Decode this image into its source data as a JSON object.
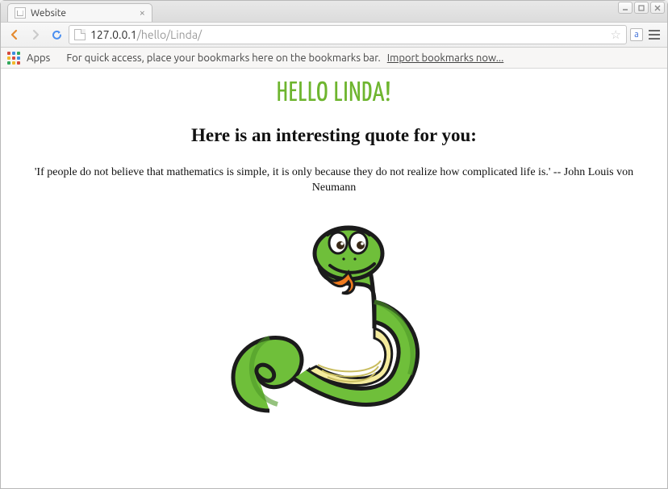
{
  "window": {
    "tab_title": "Website"
  },
  "toolbar": {
    "url_host": "127.0.0.1",
    "url_path": "/hello/Linda/"
  },
  "bookmarks_bar": {
    "apps_label": "Apps",
    "hint_text": "For quick access, place your bookmarks here on the bookmarks bar.",
    "import_link": "Import bookmarks now..."
  },
  "page": {
    "greeting": "Hello Linda!",
    "subheading": "Here is an interesting quote for you:",
    "quote": "'If people do not believe that mathematics is simple, it is only because they do not realize how complicated life is.' -- John Louis von Neumann"
  },
  "colors": {
    "accent_green": "#6eb52f"
  }
}
